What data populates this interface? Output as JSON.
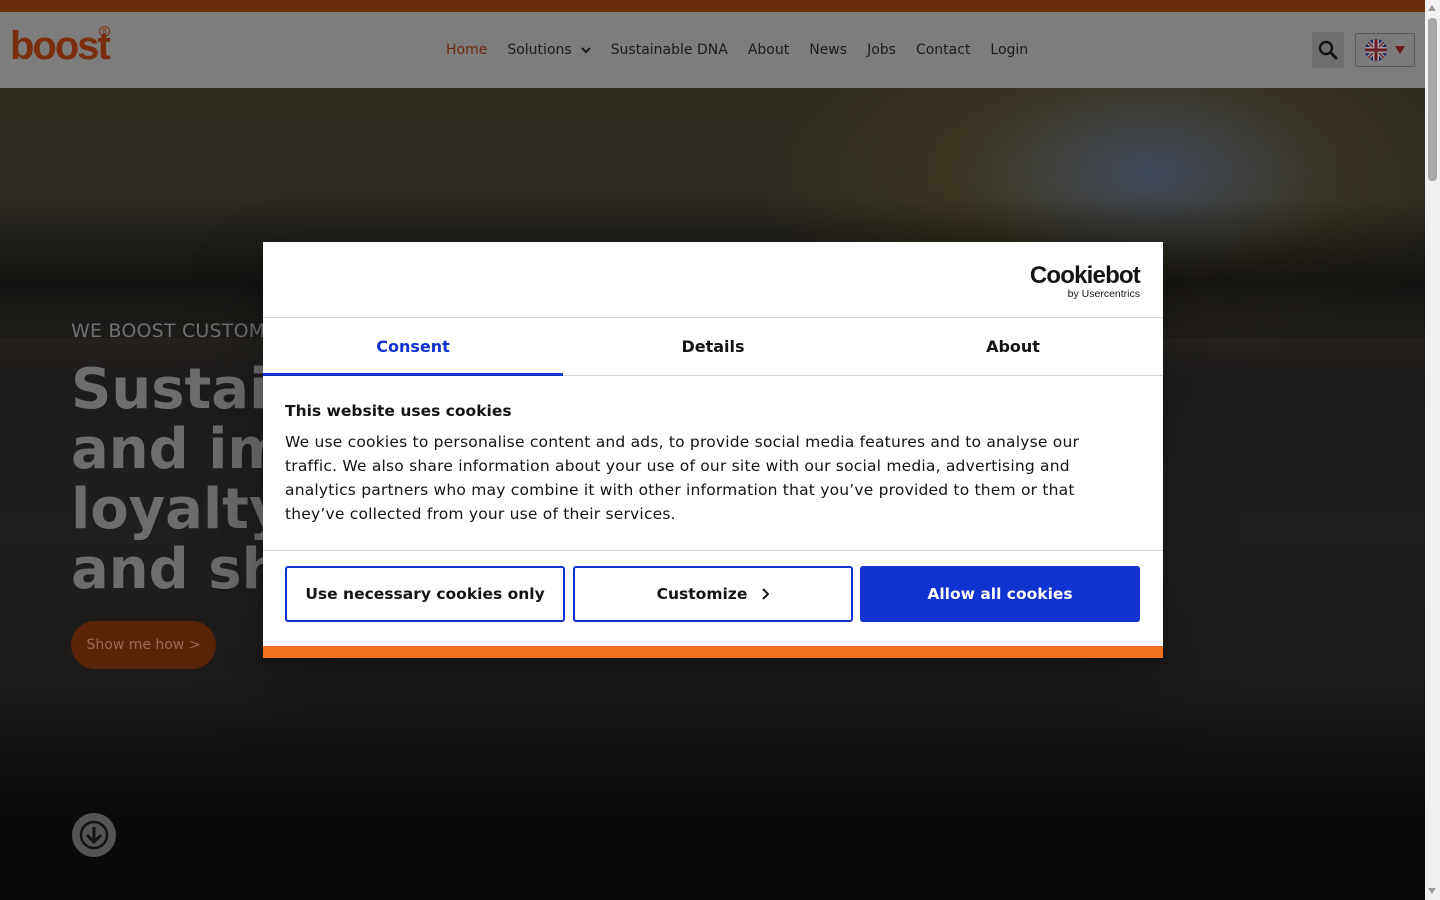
{
  "brand": {
    "logo_text": "boost",
    "accent": "#6a2d0c"
  },
  "nav": {
    "items": [
      {
        "label": "Home"
      },
      {
        "label": "Solutions"
      },
      {
        "label": "Sustainable DNA"
      },
      {
        "label": "About"
      },
      {
        "label": "News"
      },
      {
        "label": "Jobs"
      },
      {
        "label": "Contact"
      },
      {
        "label": "Login"
      }
    ],
    "active": "Home"
  },
  "hero": {
    "eyebrow": "WE BOOST CUSTOM",
    "title_lines": [
      "Sustai",
      "and im",
      "loyalty",
      "and sh"
    ],
    "cta_label": "Show me how >"
  },
  "cookie_dialog": {
    "brand_name": "Cookiebot",
    "brand_sub": "by Usercentrics",
    "tabs": [
      {
        "label": "Consent"
      },
      {
        "label": "Details"
      },
      {
        "label": "About"
      }
    ],
    "active_tab": "Consent",
    "title": "This website uses cookies",
    "text_lines": [
      "We use cookies to personalise content and ads, to provide social media features and to analyse our",
      "traffic. We also share information about your use of our site with our social media, advertising and",
      "analytics partners who may combine it with other information that you’ve provided to them or that",
      "they’ve collected from your use of their services."
    ],
    "buttons": {
      "necessary": "Use necessary cookies only",
      "customize": "Customize",
      "allow_all": "Allow all cookies"
    },
    "colors": {
      "primary": "#1032cf",
      "bottom_bar": "#f36f21"
    }
  }
}
